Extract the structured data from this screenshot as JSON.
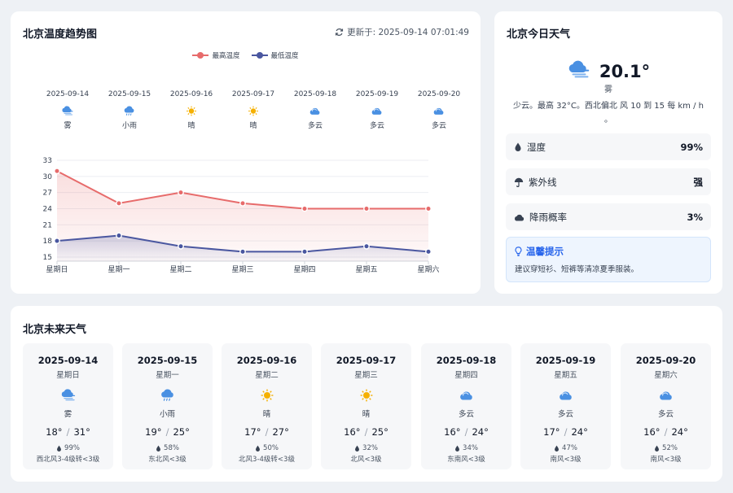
{
  "trend": {
    "title": "北京温度趋势图",
    "updated_label": "更新于: 2025-09-14 07:01:49",
    "legend_high": "最高温度",
    "legend_low": "最低温度"
  },
  "colors": {
    "high": "#e76b6b",
    "low": "#4a57a0",
    "accent": "#2563eb"
  },
  "chart_data": {
    "type": "line",
    "categories": [
      "星期日",
      "星期一",
      "星期二",
      "星期三",
      "星期四",
      "星期五",
      "星期六"
    ],
    "series": [
      {
        "name": "最高温度",
        "values": [
          31,
          25,
          27,
          25,
          24,
          24,
          24
        ]
      },
      {
        "name": "最低温度",
        "values": [
          18,
          19,
          17,
          16,
          16,
          17,
          16
        ]
      }
    ],
    "yticks": [
      15,
      18,
      21,
      24,
      27,
      30,
      33
    ],
    "ylim": [
      15,
      33
    ],
    "grid": true,
    "area_fill": true,
    "legend_position": "top-center"
  },
  "chart_days": [
    {
      "date": "2025-09-14",
      "condition": "雾",
      "icon": "fog-icon"
    },
    {
      "date": "2025-09-15",
      "condition": "小雨",
      "icon": "rain-icon"
    },
    {
      "date": "2025-09-16",
      "condition": "晴",
      "icon": "sun-icon"
    },
    {
      "date": "2025-09-17",
      "condition": "晴",
      "icon": "sun-icon"
    },
    {
      "date": "2025-09-18",
      "condition": "多云",
      "icon": "cloud-icon"
    },
    {
      "date": "2025-09-19",
      "condition": "多云",
      "icon": "cloud-icon"
    },
    {
      "date": "2025-09-20",
      "condition": "多云",
      "icon": "cloud-icon"
    }
  ],
  "today": {
    "title": "北京今日天气",
    "temp": "20.1°",
    "condition": "雾",
    "icon": "fog-icon",
    "description": "少云。最高 32°C。西北偏北 风 10 到 15 每 km / h 。",
    "stats": [
      {
        "label": "湿度",
        "value": "99%",
        "icon": "droplet-icon"
      },
      {
        "label": "紫外线",
        "value": "强",
        "icon": "umbrella-icon"
      },
      {
        "label": "降雨概率",
        "value": "3%",
        "icon": "cloud-icon"
      }
    ],
    "tip_title": "温馨提示",
    "tip_text": "建议穿短衫、短裤等清凉夏季服装。"
  },
  "future": {
    "title": "北京未来天气",
    "days": [
      {
        "date": "2025-09-14",
        "weekday": "星期日",
        "condition": "雾",
        "icon": "fog-icon",
        "low": "18°",
        "high": "31°",
        "humidity": "99%",
        "wind": "西北风3-4级转<3级"
      },
      {
        "date": "2025-09-15",
        "weekday": "星期一",
        "condition": "小雨",
        "icon": "rain-icon",
        "low": "19°",
        "high": "25°",
        "humidity": "58%",
        "wind": "东北风<3级"
      },
      {
        "date": "2025-09-16",
        "weekday": "星期二",
        "condition": "晴",
        "icon": "sun-icon",
        "low": "17°",
        "high": "27°",
        "humidity": "50%",
        "wind": "北风3-4级转<3级"
      },
      {
        "date": "2025-09-17",
        "weekday": "星期三",
        "condition": "晴",
        "icon": "sun-icon",
        "low": "16°",
        "high": "25°",
        "humidity": "32%",
        "wind": "北风<3级"
      },
      {
        "date": "2025-09-18",
        "weekday": "星期四",
        "condition": "多云",
        "icon": "cloud-icon",
        "low": "16°",
        "high": "24°",
        "humidity": "34%",
        "wind": "东南风<3级"
      },
      {
        "date": "2025-09-19",
        "weekday": "星期五",
        "condition": "多云",
        "icon": "cloud-icon",
        "low": "17°",
        "high": "24°",
        "humidity": "47%",
        "wind": "南风<3级"
      },
      {
        "date": "2025-09-20",
        "weekday": "星期六",
        "condition": "多云",
        "icon": "cloud-icon",
        "low": "16°",
        "high": "24°",
        "humidity": "52%",
        "wind": "南风<3级"
      }
    ]
  }
}
